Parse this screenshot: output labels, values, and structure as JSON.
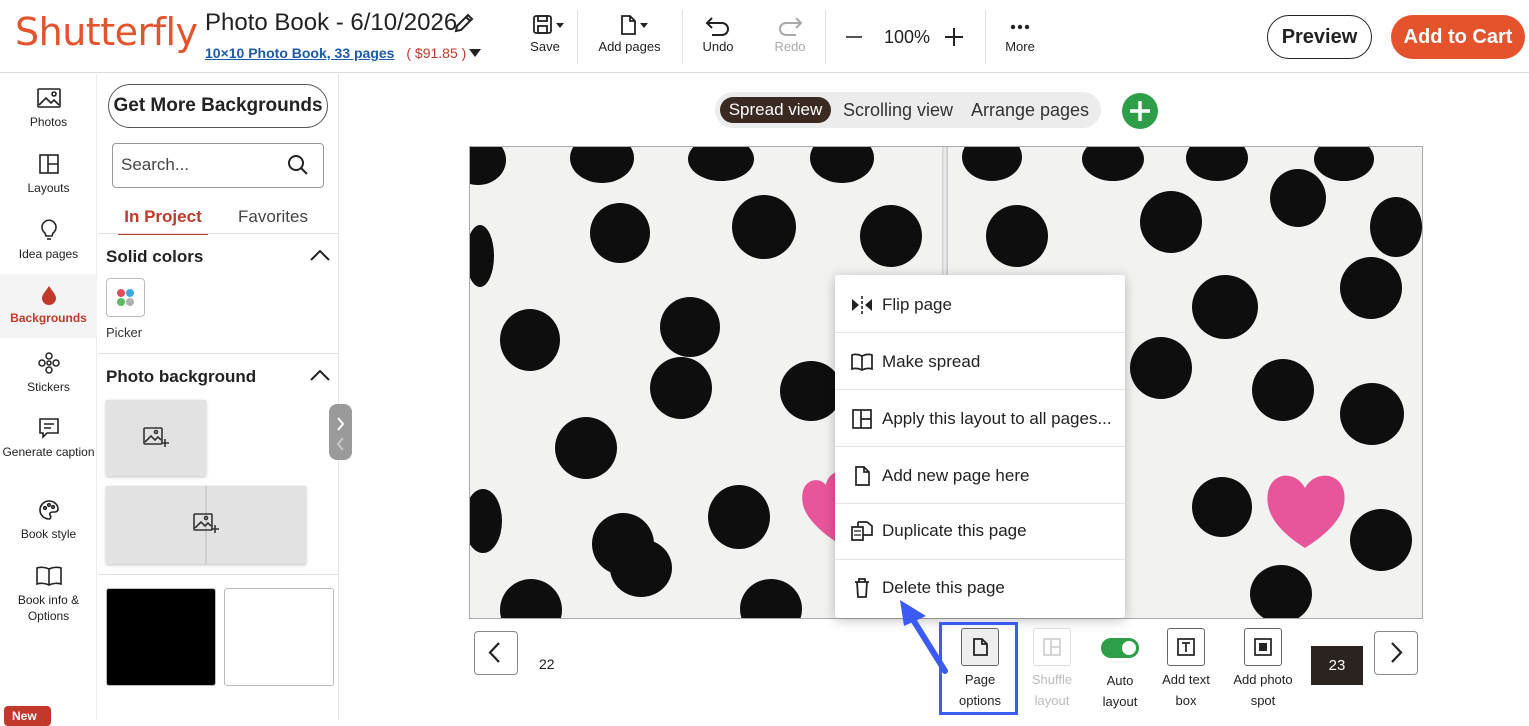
{
  "header": {
    "logo": "Shutterfly",
    "project_title": "Photo Book - 6/10/2026",
    "product_link": "10×10 Photo Book, 33 pages",
    "price": "( $91.85 )",
    "toolbar": {
      "save": "Save",
      "add_pages": "Add pages",
      "undo": "Undo",
      "redo": "Redo",
      "zoom": "100%",
      "more": "More"
    },
    "preview": "Preview",
    "add_to_cart": "Add to Cart"
  },
  "rail": {
    "items": [
      {
        "label": "Photos",
        "icon": "image-icon"
      },
      {
        "label": "Layouts",
        "icon": "layout-icon"
      },
      {
        "label": "Idea pages",
        "icon": "lightbulb-icon"
      },
      {
        "label": "Backgrounds",
        "icon": "drop-icon",
        "active": true
      },
      {
        "label": "Stickers",
        "icon": "sticker-icon"
      },
      {
        "label": "Generate caption",
        "icon": "caption-icon"
      },
      {
        "label": "Book style",
        "icon": "palette-icon"
      },
      {
        "label": "Book info & Options",
        "icon": "book-icon"
      }
    ],
    "new_badge": "New"
  },
  "panel": {
    "get_more": "Get More Backgrounds",
    "search_placeholder": "Search...",
    "tabs": [
      "In Project",
      "Favorites"
    ],
    "sections": {
      "solid_colors": "Solid colors",
      "picker": "Picker",
      "photo_background": "Photo background"
    }
  },
  "views": {
    "spread": "Spread view",
    "scrolling": "Scrolling view",
    "arrange": "Arrange pages"
  },
  "context_menu": [
    {
      "label": "Flip page",
      "icon": "flip-icon"
    },
    {
      "label": "Make spread",
      "icon": "spread-icon"
    },
    {
      "label": "Apply this layout to all pages...",
      "icon": "layout-icon"
    },
    {
      "label": "Add new page here",
      "icon": "page-add-icon"
    },
    {
      "label": "Duplicate this page",
      "icon": "duplicate-icon"
    },
    {
      "label": "Delete this page",
      "icon": "trash-icon"
    }
  ],
  "bottom": {
    "page_left": "22",
    "page_right": "23",
    "tools": {
      "page_options_1": "Page",
      "page_options_2": "options",
      "shuffle_1": "Shuffle",
      "shuffle_2": "layout",
      "auto_1": "Auto",
      "auto_2": "layout",
      "text_1": "Add text",
      "text_2": "box",
      "photo_1": "Add photo",
      "photo_2": "spot"
    },
    "auto_layout_on": true
  },
  "colors": {
    "brand": "#e5532d",
    "accent_green": "#2e9e49",
    "highlight_blue": "#3b5bf5",
    "heart_pink": "#e8559a"
  }
}
